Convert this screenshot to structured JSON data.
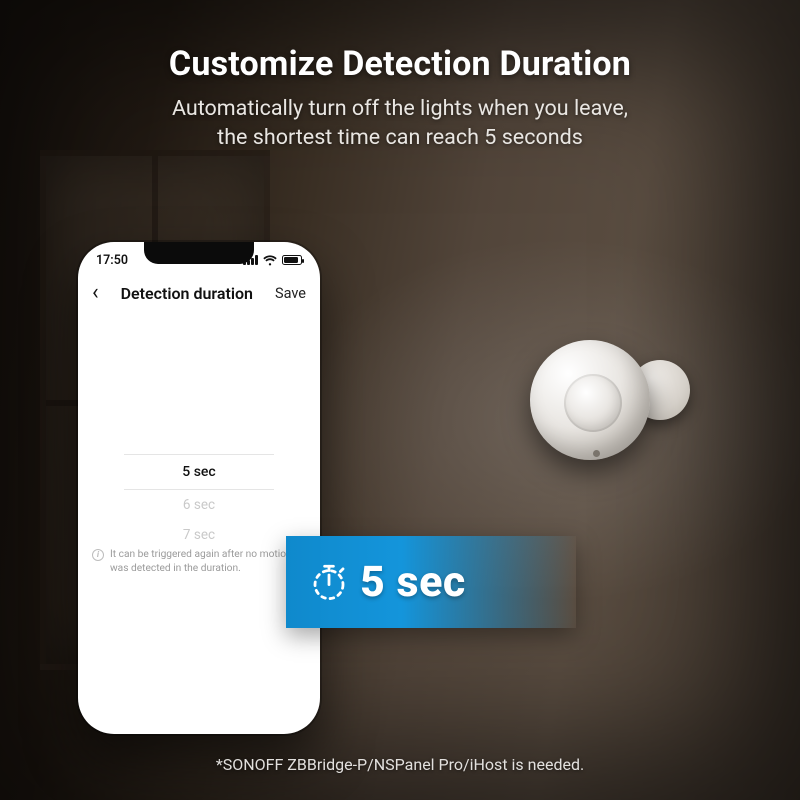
{
  "headline": {
    "title": "Customize Detection Duration",
    "sub_line1": "Automatically turn off the lights when you leave,",
    "sub_line2": "the shortest time can reach 5 seconds"
  },
  "phone": {
    "status": {
      "time": "17:50"
    },
    "nav": {
      "back_glyph": "‹",
      "title": "Detection duration",
      "save": "Save"
    },
    "picker": {
      "selected": "5 sec",
      "option_below_1": "6 sec",
      "option_below_2": "7 sec"
    },
    "helper_text": "It can be triggered again after no motion was detected in the duration."
  },
  "banner": {
    "label": "5 sec"
  },
  "footnote": "*SONOFF ZBBridge-P/NSPanel Pro/iHost is needed."
}
